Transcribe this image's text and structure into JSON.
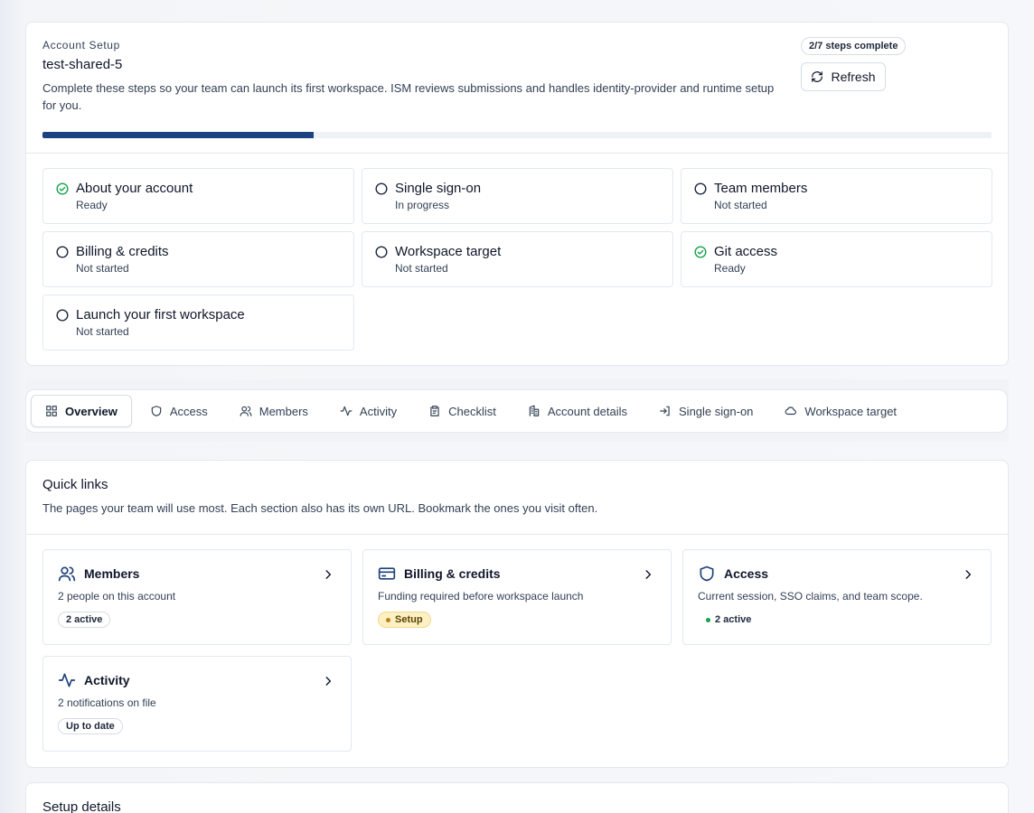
{
  "setup": {
    "eyebrow": "Account Setup",
    "account_name": "test-shared-5",
    "description": "Complete these steps so your team can launch its first workspace. ISM reviews submissions and handles identity-provider and runtime setup for you.",
    "steps_badge": "2/7 steps complete",
    "refresh_label": "Refresh",
    "progress": 0.2857,
    "steps": [
      {
        "title": "About your account",
        "status": "Ready",
        "done": true
      },
      {
        "title": "Single sign-on",
        "status": "In progress",
        "done": false
      },
      {
        "title": "Team members",
        "status": "Not started",
        "done": false
      },
      {
        "title": "Billing & credits",
        "status": "Not started",
        "done": false
      },
      {
        "title": "Workspace target",
        "status": "Not started",
        "done": false
      },
      {
        "title": "Git access",
        "status": "Ready",
        "done": true
      },
      {
        "title": "Launch your first workspace",
        "status": "Not started",
        "done": false
      }
    ]
  },
  "tabs": [
    {
      "label": "Overview",
      "icon": "grid-icon",
      "active": true
    },
    {
      "label": "Access",
      "icon": "shield-icon"
    },
    {
      "label": "Members",
      "icon": "users-icon"
    },
    {
      "label": "Activity",
      "icon": "activity-icon"
    },
    {
      "label": "Checklist",
      "icon": "clipboard-icon"
    },
    {
      "label": "Account details",
      "icon": "building-icon"
    },
    {
      "label": "Single sign-on",
      "icon": "login-icon"
    },
    {
      "label": "Workspace target",
      "icon": "cloud-icon"
    }
  ],
  "quick_links": {
    "title": "Quick links",
    "description": "The pages your team will use most. Each section also has its own URL. Bookmark the ones you visit often.",
    "items": [
      {
        "title": "Members",
        "icon": "users-icon",
        "desc": "2 people on this account",
        "badge": "2 active",
        "badge_style": "outline"
      },
      {
        "title": "Billing & credits",
        "icon": "credit-card-icon",
        "desc": "Funding required before workspace launch",
        "badge": "Setup",
        "badge_style": "warn"
      },
      {
        "title": "Access",
        "icon": "shield-icon",
        "desc": "Current session, SSO claims, and team scope.",
        "badge": "2 active",
        "badge_style": "plain"
      },
      {
        "title": "Activity",
        "icon": "activity-icon",
        "desc": "2 notifications on file",
        "badge": "Up to date",
        "badge_style": "outline"
      }
    ]
  },
  "details": {
    "title": "Setup details"
  },
  "colors": {
    "progress": "#1d4282",
    "ready": "#16a34a",
    "pending": "#1e293b",
    "icon_accent": "#1d3f7a",
    "warn_dot": "#b8860b",
    "active_dot": "#16a34a"
  }
}
